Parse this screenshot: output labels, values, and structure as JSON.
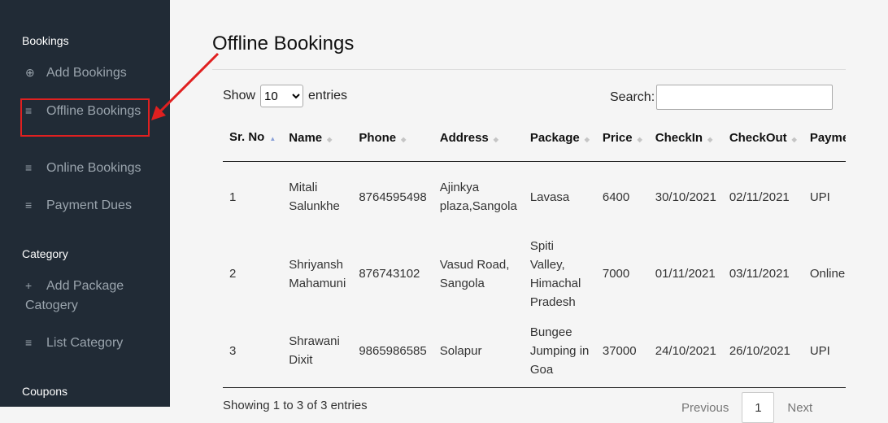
{
  "sidebar": {
    "sections": [
      {
        "title": "Bookings"
      },
      {
        "title": "Category"
      },
      {
        "title": "Coupons"
      }
    ],
    "items": [
      {
        "icon": "⊕",
        "label": "Add Bookings"
      },
      {
        "icon": "≡",
        "label": "Offline Bookings"
      },
      {
        "icon": "≡",
        "label": "Online Bookings"
      },
      {
        "icon": "≡",
        "label": "Payment Dues"
      },
      {
        "icon": "+",
        "label": "Add Package Catogery"
      },
      {
        "icon": "≡",
        "label": "List Category"
      }
    ]
  },
  "page": {
    "title": "Offline Bookings",
    "show_label": "Show",
    "entries_label": "entries",
    "page_length": "10",
    "search_label": "Search:",
    "info": "Showing 1 to 3 of 3 entries",
    "prev": "Previous",
    "current_page": "1",
    "next": "Next"
  },
  "table": {
    "headers": [
      "Sr. No",
      "Name",
      "Phone",
      "Address",
      "Package",
      "Price",
      "CheckIn",
      "CheckOut",
      "Payment"
    ],
    "rows": [
      [
        "1",
        "Mitali Salunkhe",
        "8764595498",
        "Ajinkya plaza,Sangola",
        "Lavasa",
        "6400",
        "30/10/2021",
        "02/11/2021",
        "UPI"
      ],
      [
        "2",
        "Shriyansh Mahamuni",
        "876743102",
        "Vasud Road, Sangola",
        "Spiti Valley, Himachal Pradesh",
        "7000",
        "01/11/2021",
        "03/11/2021",
        "Online"
      ],
      [
        "3",
        "Shrawani Dixit",
        "9865986585",
        "Solapur",
        "Bungee Jumping in Goa",
        "37000",
        "24/10/2021",
        "26/10/2021",
        "UPI"
      ]
    ]
  },
  "colors": {
    "sidebar_bg": "#212b36",
    "highlight": "#e02020"
  }
}
